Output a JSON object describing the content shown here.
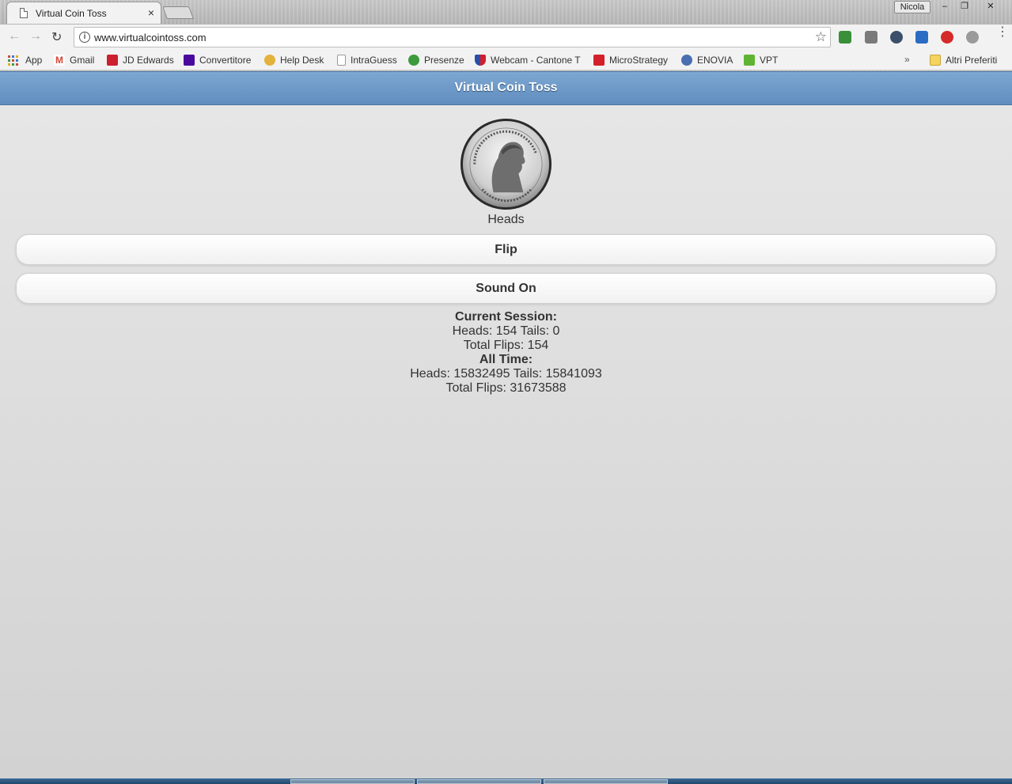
{
  "browser": {
    "tab_title": "Virtual Coin Toss",
    "tab_close": "×",
    "user_name": "Nicola",
    "window_controls": [
      "–",
      "❐",
      "✕"
    ],
    "url": "www.virtualcointoss.com",
    "bookmarks": [
      {
        "label": "App",
        "icon": "apps-grid-icon",
        "color": "#d04a3a"
      },
      {
        "label": "Gmail",
        "icon": "gmail-icon",
        "color": "#d44638"
      },
      {
        "label": "JD Edwards",
        "icon": "jd-edwards-icon",
        "color": "#cc1f2f"
      },
      {
        "label": "Convertitore",
        "icon": "yahoo-icon",
        "color": "#4a0a9e"
      },
      {
        "label": "Help Desk",
        "icon": "help-desk-icon",
        "color": "#e2b23a"
      },
      {
        "label": "IntraGuess",
        "icon": "page-icon",
        "color": "#999999"
      },
      {
        "label": "Presenze",
        "icon": "presenze-icon",
        "color": "#3d9a3d"
      },
      {
        "label": "Webcam - Cantone T",
        "icon": "webcam-shield-icon",
        "color": "#2a4fa8"
      },
      {
        "label": "MicroStrategy",
        "icon": "microstrategy-icon",
        "color": "#d4202a"
      },
      {
        "label": "ENOVIA",
        "icon": "enovia-icon",
        "color": "#4a6fb0"
      },
      {
        "label": "VPT",
        "icon": "vpt-icon",
        "color": "#5fb533"
      }
    ],
    "bookmarks_overflow": "»",
    "other_bookmarks": "Altri Preferiti"
  },
  "page": {
    "title": "Virtual Coin Toss",
    "coin_result": "Heads",
    "flip_label": "Flip",
    "sound_label": "Sound On",
    "current_session_heading": "Current Session:",
    "current_session_counts": "Heads: 154 Tails: 0",
    "current_session_total": "Total Flips: 154",
    "all_time_heading": "All Time:",
    "all_time_counts": "Heads: 15832495 Tails: 15841093",
    "all_time_total": "Total Flips: 31673588"
  }
}
